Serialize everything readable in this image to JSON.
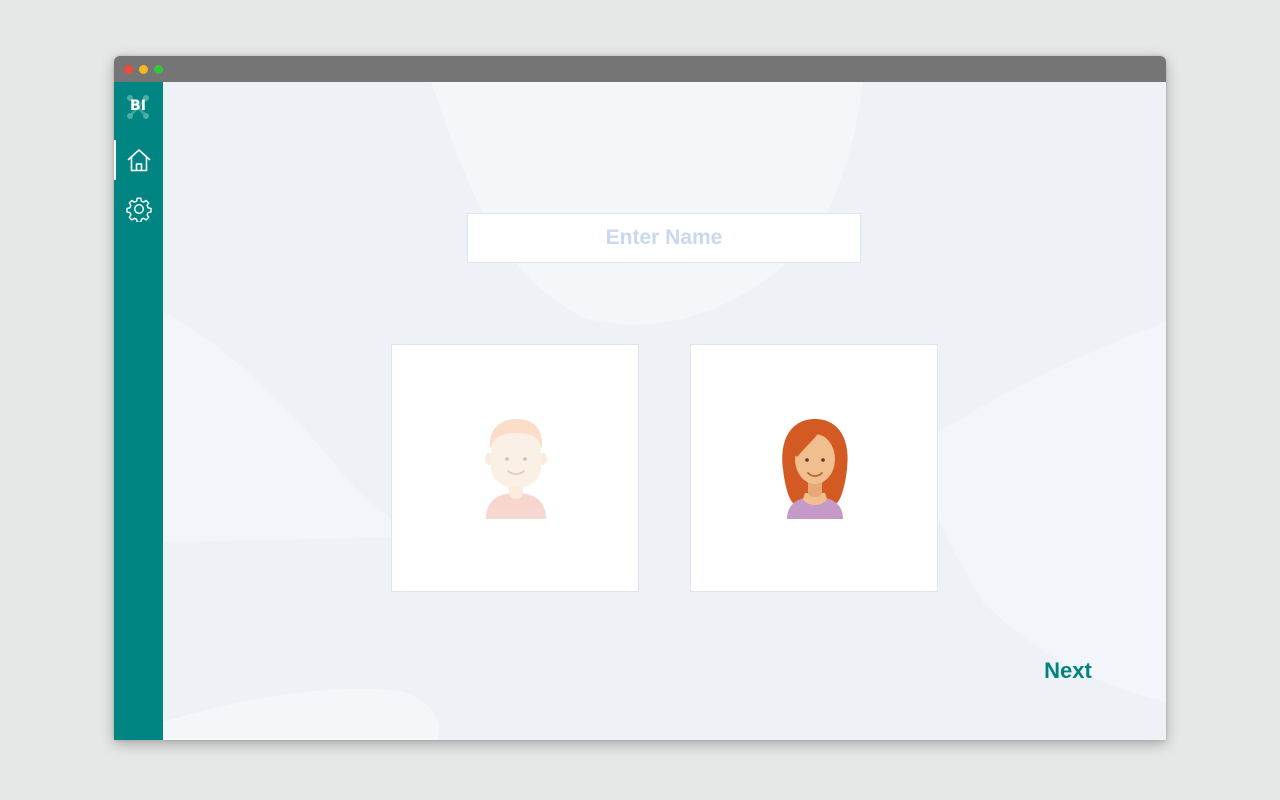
{
  "app": {
    "logo_text": "BI"
  },
  "sidebar": {
    "items": [
      {
        "icon": "home-icon",
        "active": true
      },
      {
        "icon": "gear-icon",
        "active": false
      }
    ]
  },
  "form": {
    "name_placeholder": "Enter Name",
    "name_value": ""
  },
  "avatars": [
    {
      "id": "male",
      "selected": false
    },
    {
      "id": "female",
      "selected": true
    }
  ],
  "actions": {
    "next_label": "Next"
  },
  "colors": {
    "sidebar": "#008583",
    "accent": "#00837f",
    "placeholder": "#c9d8ee",
    "background": "#eef2f6"
  }
}
